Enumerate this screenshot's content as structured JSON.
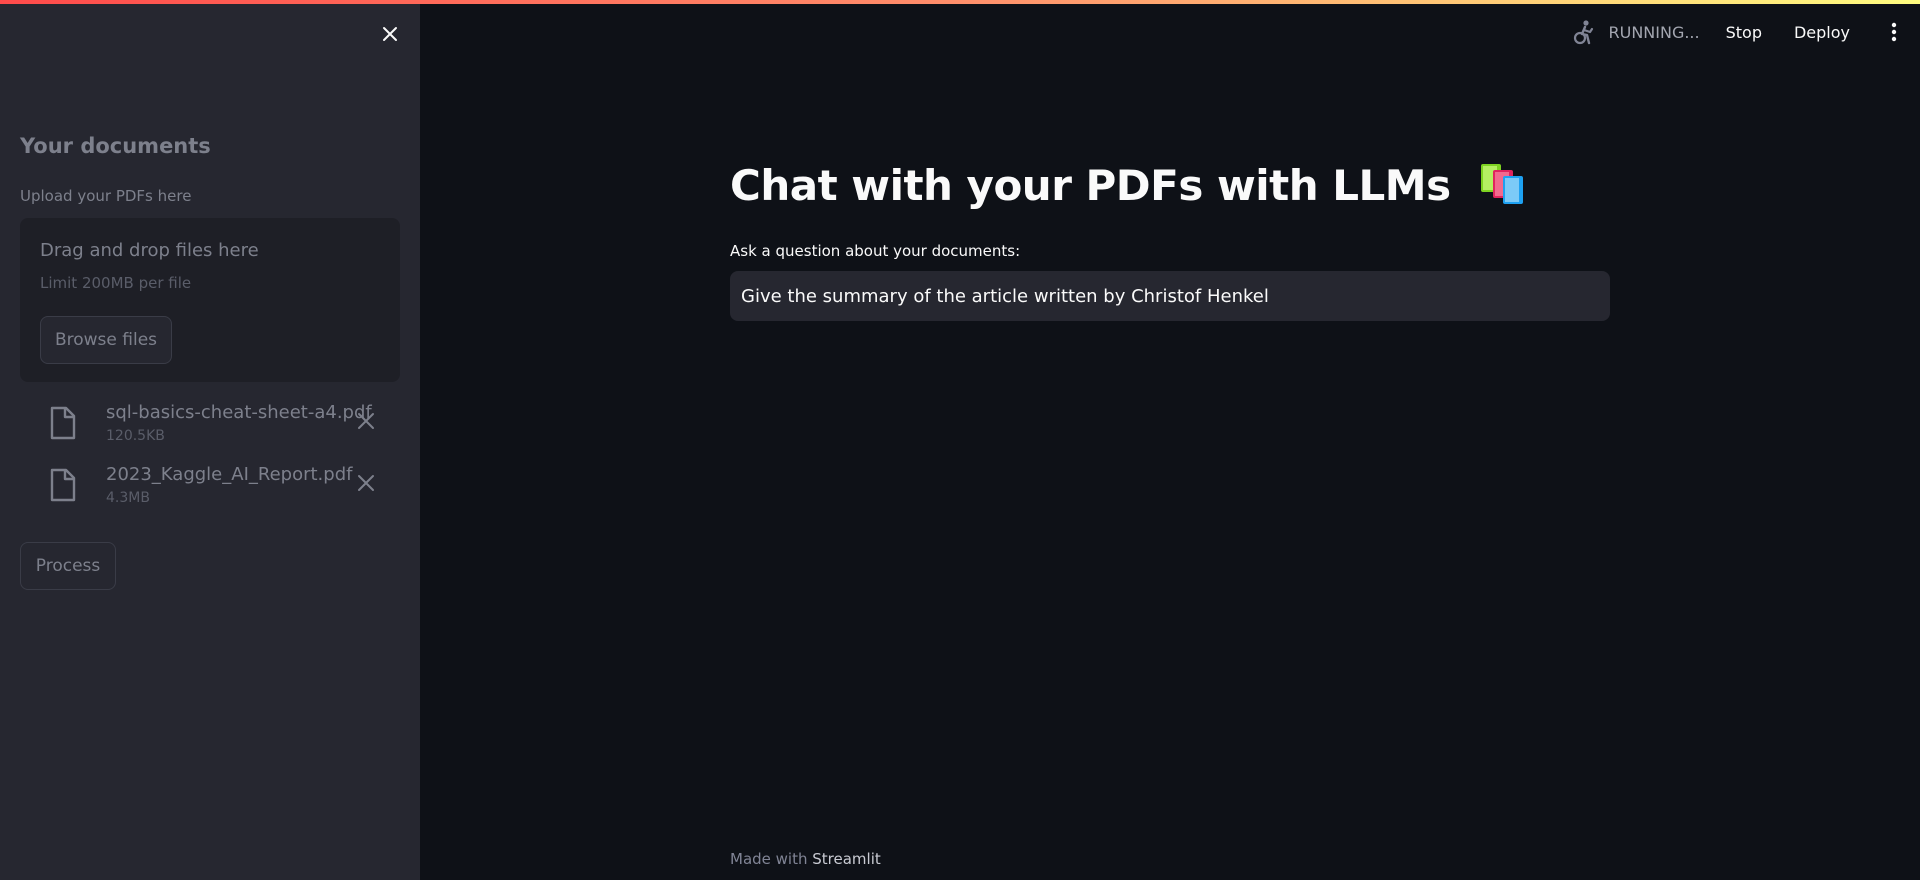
{
  "header": {
    "status": "RUNNING...",
    "stop_label": "Stop",
    "deploy_label": "Deploy"
  },
  "sidebar": {
    "title": "Your documents",
    "upload_label": "Upload your PDFs here",
    "dropzone": {
      "title": "Drag and drop files here",
      "limit": "Limit 200MB per file",
      "browse_label": "Browse files"
    },
    "files": [
      {
        "name": "sql-basics-cheat-sheet-a4.pdf",
        "size": "120.5KB"
      },
      {
        "name": "2023_Kaggle_AI_Report.pdf",
        "size": "4.3MB"
      }
    ],
    "process_label": "Process"
  },
  "main": {
    "title": "Chat with your PDFs with LLMs",
    "question_label": "Ask a question about your documents:",
    "question_value": "Give the summary of the article written by Christof Henkel"
  },
  "footer": {
    "made_with": "Made with",
    "brand": "Streamlit"
  },
  "colors": {
    "background": "#0e1117",
    "sidebar": "#262730",
    "accent": "#ff4b4b"
  }
}
